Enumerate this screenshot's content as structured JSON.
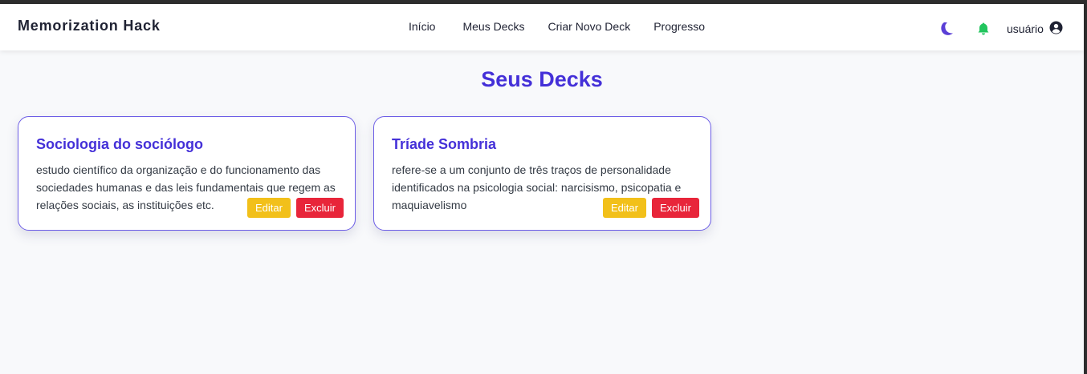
{
  "brand": "Memorization Hack",
  "nav": {
    "links": [
      "Início",
      "Meus Decks",
      "Criar Novo Deck",
      "Progresso"
    ],
    "user_label": "usuário",
    "icons": {
      "theme": "moon-icon",
      "notifications": "bell-icon",
      "user": "user-circle-icon"
    }
  },
  "page_title": "Seus Decks",
  "decks": [
    {
      "title": "Sociologia do sociólogo",
      "description": "estudo científico da organização e do funcionamento das sociedades humanas e das leis fundamentais que regem as relações sociais, as instituições etc.",
      "edit_label": "Editar",
      "delete_label": "Excluir"
    },
    {
      "title": "Tríade Sombria",
      "description": "refere-se a um conjunto de três traços de personalidade identificados na psicologia social: narcisismo, psicopatia e maquiavelismo",
      "edit_label": "Editar",
      "delete_label": "Excluir"
    }
  ],
  "colors": {
    "accent": "#4430d8",
    "edit": "#f2c01a",
    "delete": "#e8253a",
    "bell": "#22c55e",
    "moon": "#5a3fd6"
  }
}
